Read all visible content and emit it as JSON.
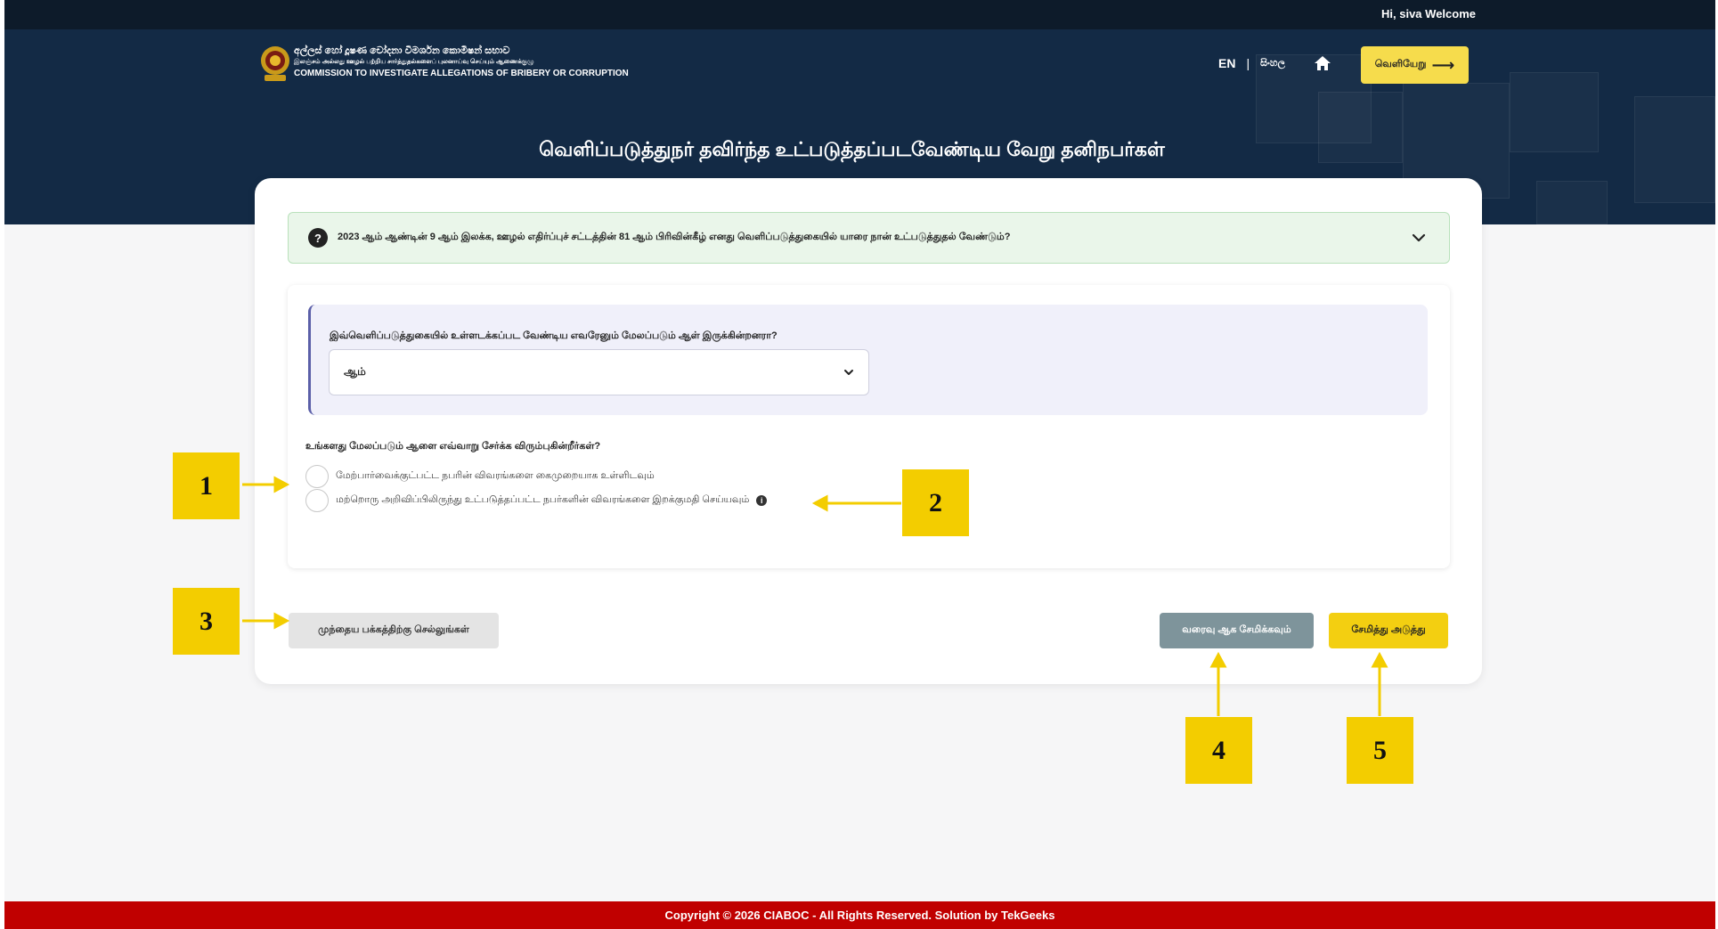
{
  "header": {
    "welcome": "Hi, siva Welcome",
    "org_line1": "අල්ලස් හෝ දූෂණ චෝදනා විමර්ශන කොමිෂන් සභාව",
    "org_line2": "இலஞ்சம் அல்லது ஊழல் பற்றிய சார்த்துதல்களைப் புலனாய்வு செய்யும் ஆணைக்குழு",
    "org_line3": "COMMISSION TO INVESTIGATE ALLEGATIONS OF BRIBERY OR CORRUPTION",
    "lang_en": "EN",
    "lang_sep": "|",
    "lang_si": "සිංහල",
    "logout_label": "வெளியேறு",
    "logout_arrow": "⟶",
    "home_icon": "home-icon"
  },
  "page": {
    "title": "வெளிப்படுத்துநர் தவிர்ந்த உட்படுத்தப்படவேண்டிய வேறு தனிநபர்கள்"
  },
  "faq": {
    "icon": "?",
    "question": "2023 ஆம் ஆண்டின் 9 ஆம் இலக்க, ஊழல் எதிர்ப்புச் சட்டத்தின் 81 ஆம் பிரிவின்கீழ் எனது வெளிப்படுத்துகையில் யாரை நான் உட்படுத்துதல் வேண்டும்?"
  },
  "form": {
    "question_label": "இவ்வெளிப்படுத்துகையில் உள்ளடக்கப்பட வேண்டிய எவரேனும் மேலப்படும் ஆள் இருக்கின்றனரா?",
    "select_value": "ஆம்",
    "how_label": "உங்களது மேலப்படும் ஆளை எவ்வாறு சேர்க்க விரும்புகின்றீர்கள்?",
    "options": [
      "மேற்பார்வைக்குட்பட்ட நபரின் விவரங்களை கைமுறையாக உள்ளிடவும்",
      "மற்றொரு அறிவிப்பிலிருந்து உட்படுத்தப்பட்ட நபர்களின் விவரங்களை இறக்குமதி செய்யவும்"
    ],
    "info_icon": "i"
  },
  "buttons": {
    "prev": "முந்தைய பக்கத்திற்கு செல்லுங்கள்",
    "draft": "வரைவு ஆக சேமிக்கவும்",
    "next": "சேமித்து அடுத்து"
  },
  "footer": {
    "copyright": "Copyright © 2026 CIABOC - All Rights Reserved. Solution by TekGeeks"
  },
  "callouts": [
    "1",
    "2",
    "3",
    "4",
    "5"
  ],
  "colors": {
    "navy": "#132a45",
    "topbar": "#0d1b2a",
    "accent_yellow": "#f3cf11",
    "callout_yellow": "#f3cd00",
    "footer_red": "#c00000",
    "draft_grey": "#7e949b",
    "faq_green": "#eaf6ea"
  }
}
